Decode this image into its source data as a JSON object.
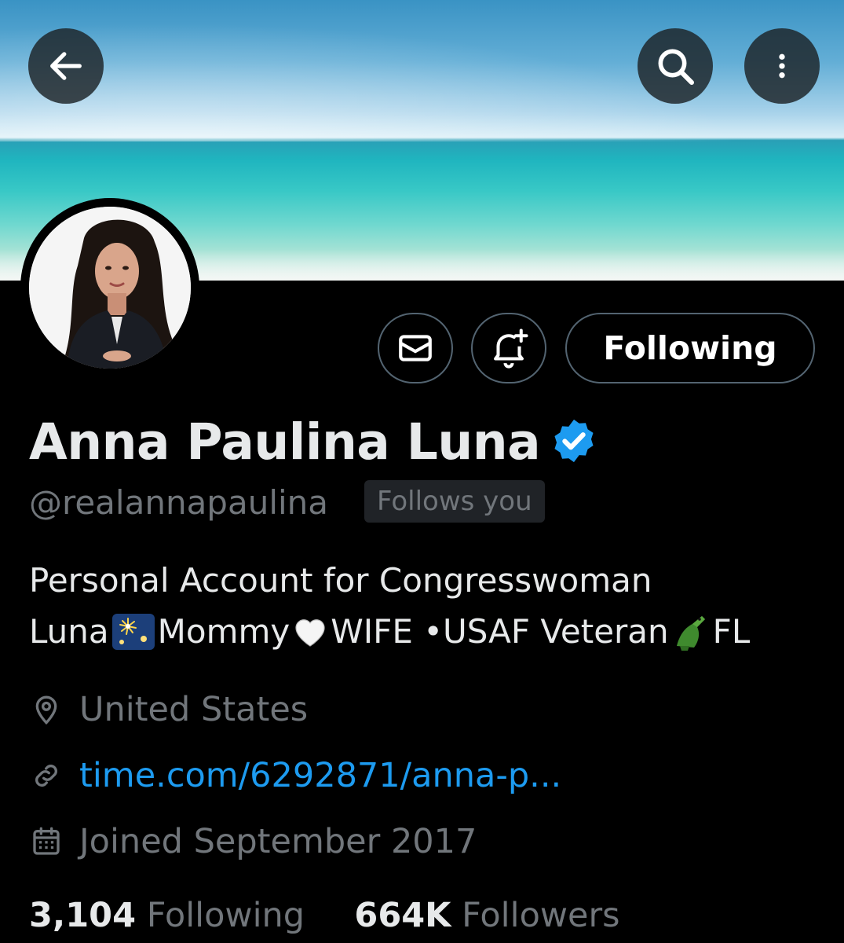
{
  "header": {
    "back_icon": "arrow-left-icon",
    "search_icon": "search-icon",
    "more_icon": "more-vertical-icon"
  },
  "actions": {
    "message_icon": "envelope-icon",
    "notify_icon": "bell-plus-icon",
    "follow_label": "Following"
  },
  "profile": {
    "name": "Anna Paulina Luna",
    "verified_icon": "verified-badge-icon",
    "handle": "@realannapaulina",
    "follows_you": "Follows you",
    "bio_line1": "Personal Account for Congresswoman",
    "bio_line2_a": "Luna",
    "bio_line2_b": "Mommy",
    "bio_line2_c": "WIFE •USAF Veteran",
    "bio_line2_d": "FL",
    "location": "United States",
    "website": "time.com/6292871/anna-p...",
    "joined": "Joined September 2017"
  },
  "stats": {
    "following_count": "3,104",
    "following_label": "Following",
    "followers_count": "664K",
    "followers_label": "Followers"
  },
  "colors": {
    "background": "#000000",
    "text_primary": "#e7e9ea",
    "text_secondary": "#71767b",
    "link": "#1d9bf0",
    "verified": "#1d9bf0",
    "border": "#536471"
  }
}
